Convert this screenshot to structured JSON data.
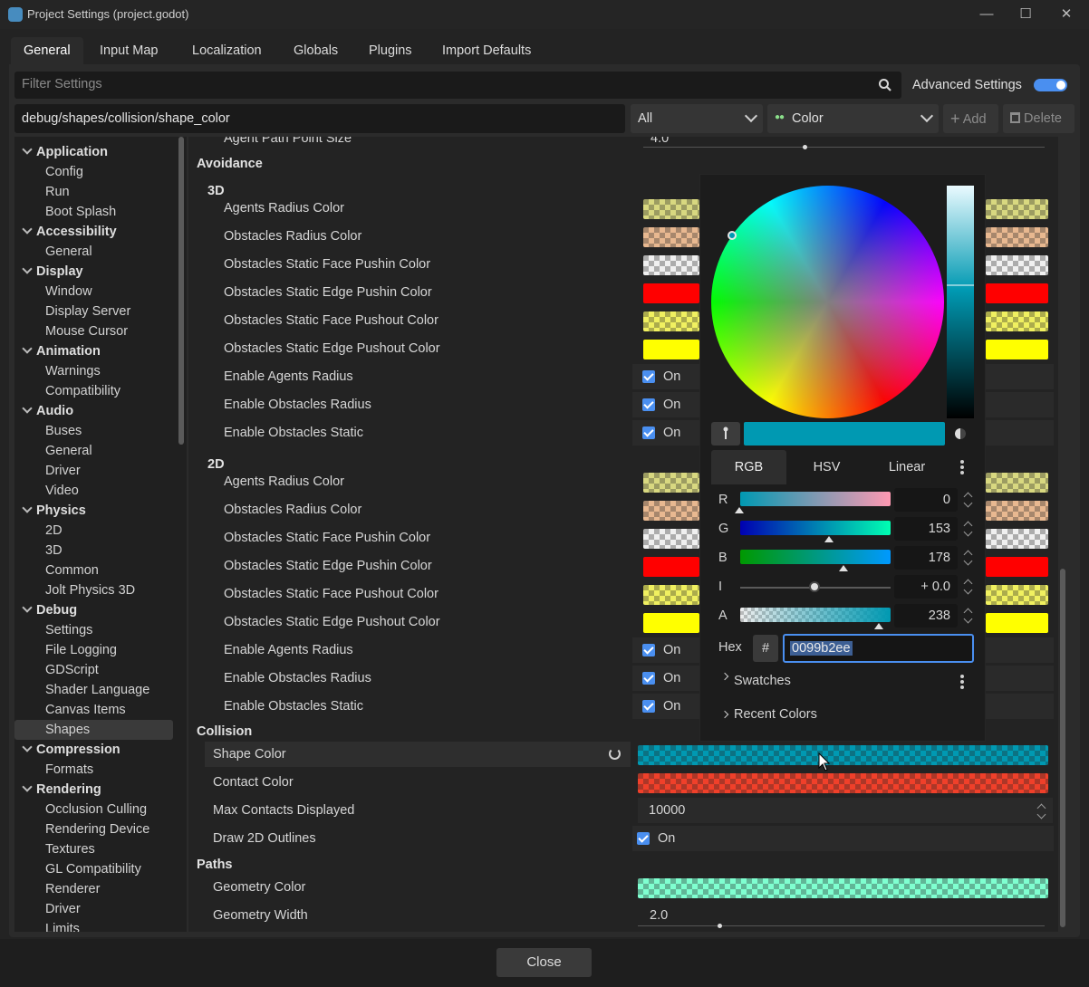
{
  "window": {
    "title": "Project Settings (project.godot)"
  },
  "tabs": [
    "General",
    "Input Map",
    "Localization",
    "Globals",
    "Plugins",
    "Import Defaults"
  ],
  "filter": {
    "placeholder": "Filter Settings",
    "advanced_label": "Advanced Settings",
    "advanced_on": true
  },
  "path_bar": {
    "value": "debug/shapes/collision/shape_color",
    "scope": "All",
    "type": "Color",
    "add_label": "Add",
    "delete_label": "Delete"
  },
  "tree": [
    {
      "cat": "Application",
      "items": [
        "Config",
        "Run",
        "Boot Splash"
      ]
    },
    {
      "cat": "Accessibility",
      "items": [
        "General"
      ]
    },
    {
      "cat": "Display",
      "items": [
        "Window",
        "Display Server",
        "Mouse Cursor"
      ]
    },
    {
      "cat": "Animation",
      "items": [
        "Warnings",
        "Compatibility"
      ]
    },
    {
      "cat": "Audio",
      "items": [
        "Buses",
        "General",
        "Driver",
        "Video"
      ]
    },
    {
      "cat": "Physics",
      "items": [
        "2D",
        "3D",
        "Common",
        "Jolt Physics 3D"
      ]
    },
    {
      "cat": "Debug",
      "items": [
        "Settings",
        "File Logging",
        "GDScript",
        "Shader Language",
        "Canvas Items",
        "Shapes"
      ]
    },
    {
      "cat": "Compression",
      "items": [
        "Formats"
      ]
    },
    {
      "cat": "Rendering",
      "items": [
        "Occlusion Culling",
        "Rendering Device",
        "Textures",
        "GL Compatibility",
        "Renderer",
        "Driver",
        "Limits"
      ]
    }
  ],
  "tree_selected": "Shapes",
  "inspector": {
    "top_partial": {
      "label": "Agent Path Point Size",
      "value": "4.0"
    },
    "avoidance_label": "Avoidance",
    "sub3d": "3D",
    "sub2d": "2D",
    "avoid_rows": [
      {
        "label": "Agents Radius Color",
        "kind": "color",
        "color": "#d8d880"
      },
      {
        "label": "Obstacles Radius Color",
        "kind": "color",
        "color": "#e8b890"
      },
      {
        "label": "Obstacles Static Face Pushin Color",
        "kind": "color",
        "color": "#f0f0f0"
      },
      {
        "label": "Obstacles Static Edge Pushin Color",
        "kind": "color",
        "color": "#ff0000"
      },
      {
        "label": "Obstacles Static Face Pushout Color",
        "kind": "color",
        "color": "#f0f060"
      },
      {
        "label": "Obstacles Static Edge Pushout Color",
        "kind": "color",
        "color": "#ffff00"
      },
      {
        "label": "Enable Agents Radius",
        "kind": "bool",
        "value": "On"
      },
      {
        "label": "Enable Obstacles Radius",
        "kind": "bool",
        "value": "On"
      },
      {
        "label": "Enable Obstacles Static",
        "kind": "bool",
        "value": "On"
      }
    ],
    "collision_label": "Collision",
    "collision_rows": [
      {
        "label": "Shape Color",
        "kind": "color",
        "color": "#0099b2"
      },
      {
        "label": "Contact Color",
        "kind": "color",
        "color": "#f0402a"
      },
      {
        "label": "Max Contacts Displayed",
        "kind": "number",
        "value": "10000"
      },
      {
        "label": "Draw 2D Outlines",
        "kind": "bool",
        "value": "On"
      }
    ],
    "paths_label": "Paths",
    "paths_rows": [
      {
        "label": "Geometry Color",
        "kind": "color",
        "color": "#7fffd0"
      },
      {
        "label": "Geometry Width",
        "kind": "slider",
        "value": "2.0"
      }
    ]
  },
  "color_picker": {
    "modes": [
      "RGB",
      "HSV",
      "Linear"
    ],
    "channels": [
      {
        "label": "R",
        "value": "0"
      },
      {
        "label": "G",
        "value": "153"
      },
      {
        "label": "B",
        "value": "178"
      },
      {
        "label": "I",
        "value": "+ 0.0"
      },
      {
        "label": "A",
        "value": "238"
      }
    ],
    "hex_label": "Hex",
    "hash": "#",
    "hex_value": "0099b2ee",
    "swatches_label": "Swatches",
    "recent_label": "Recent Colors",
    "current_color": "#0099b2"
  },
  "close_label": "Close"
}
